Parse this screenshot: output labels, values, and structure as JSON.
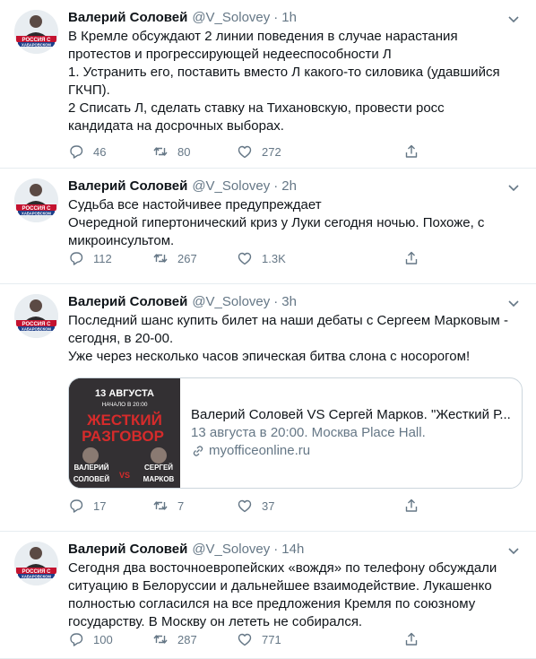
{
  "author": {
    "name": "Валерий Соловей",
    "handle": "@V_Solovey",
    "avatar_text": [
      "РОССИЯ С",
      "ХАБАРОВСКОМ"
    ]
  },
  "colors": {
    "text": "#0f1419",
    "secondary": "#657786",
    "border": "#e6ecf0",
    "card_border": "#ccd6dd"
  },
  "tweets": [
    {
      "time": "1h",
      "lines": [
        "В Кремле обсуждают 2 линии поведения в случае нарастания",
        "протестов и прогрессирующей  недееспособности Л",
        "1. Устранить его,  поставить вместо Л какого-то силовика (удавшийся",
        "ГКЧП).",
        "2 Списать Л, сделать ставку на Тихановскую,  провести росс",
        "кандидата на досрочных выборах."
      ],
      "replies": "46",
      "retweets": "80",
      "likes": "272"
    },
    {
      "time": "2h",
      "lines": [
        "Судьба все настойчивее предупреждает",
        "Очередной гипертонический криз у Луки сегодня ночью. Похоже, с",
        "микроинсультом."
      ],
      "replies": "112",
      "retweets": "267",
      "likes": "1.3K"
    },
    {
      "time": "3h",
      "lines": [
        "Последний шанс купить билет на наши дебаты с Сергеем Марковым -",
        "сегодня, в 20-00.",
        "Уже через несколько часов эпическая битва слона с носорогом!"
      ],
      "replies": "17",
      "retweets": "7",
      "likes": "37",
      "card": {
        "title": "Валерий Соловей VS Сергей Марков. \"Жесткий Р...",
        "description": "13 августа в 20:00. Москва Place Hall.",
        "url": "myofficeonline.ru",
        "image": {
          "date": "13 АВГУСТА",
          "start": "НАЧАЛО В 20:00",
          "headline_1": "ЖЕСТКИЙ",
          "headline_2": "РАЗГОВОР",
          "left_name_1": "ВАЛЕРИЙ",
          "left_name_2": "СОЛОВЕЙ",
          "vs": "VS",
          "right_name_1": "СЕРГЕЙ",
          "right_name_2": "МАРКОВ"
        }
      }
    },
    {
      "time": "14h",
      "lines": [
        "Сегодня два восточноевропейских «вождя» по телефону обсуждали",
        "ситуацию в Белоруссии и дальнейшее взаимодействие. Лукашенко",
        "полностью согласился на все предложения Кремля по союзному",
        "государству. В Москву он лететь не собирался."
      ],
      "replies": "100",
      "retweets": "287",
      "likes": "771"
    }
  ]
}
